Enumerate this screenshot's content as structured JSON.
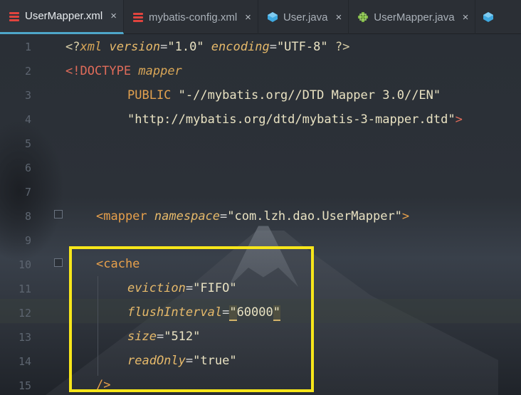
{
  "tabs": [
    {
      "label": "UserMapper.xml",
      "icon": "xml-file-icon",
      "active": true
    },
    {
      "label": "mybatis-config.xml",
      "icon": "xml-file-icon",
      "active": false
    },
    {
      "label": "User.java",
      "icon": "java-class-icon",
      "active": false
    },
    {
      "label": "UserMapper.java",
      "icon": "java-interface-icon",
      "active": false
    }
  ],
  "close_glyph": "×",
  "line_numbers": [
    "1",
    "2",
    "3",
    "4",
    "5",
    "6",
    "7",
    "8",
    "9",
    "10",
    "11",
    "12",
    "13",
    "14",
    "15"
  ],
  "code": {
    "l1_open": "<?",
    "l1_xml": "xml",
    "l1_version_attr": "version",
    "l1_version_val": "\"1.0\"",
    "l1_encoding_attr": "encoding",
    "l1_encoding_val": "\"UTF-8\"",
    "l1_close": "?>",
    "l2_doctype": "<!DOCTYPE",
    "l2_mapper": "mapper",
    "l3_public": "PUBLIC",
    "l3_string": "\"-//mybatis.org//DTD Mapper 3.0//EN\"",
    "l4_string": "\"http://mybatis.org/dtd/mybatis-3-mapper.dtd\"",
    "l4_close": ">",
    "l8_open": "<mapper",
    "l8_attr": "namespace",
    "l8_val": "\"com.lzh.dao.UserMapper\"",
    "l8_close": ">",
    "l10_open": "<cache",
    "l11_attr": "eviction",
    "l11_val": "\"FIFO\"",
    "l12_attr": "flushInterval",
    "l12_q1": "\"",
    "l12_val": "60000",
    "l12_q2": "\"",
    "l13_attr": "size",
    "l13_val": "\"512\"",
    "l14_attr": "readOnly",
    "l14_val": "\"true\"",
    "l15_close": "/>",
    "eq": "="
  },
  "colors": {
    "highlight_box": "#f7e61a",
    "active_tab_underline": "#4ea6c9"
  }
}
